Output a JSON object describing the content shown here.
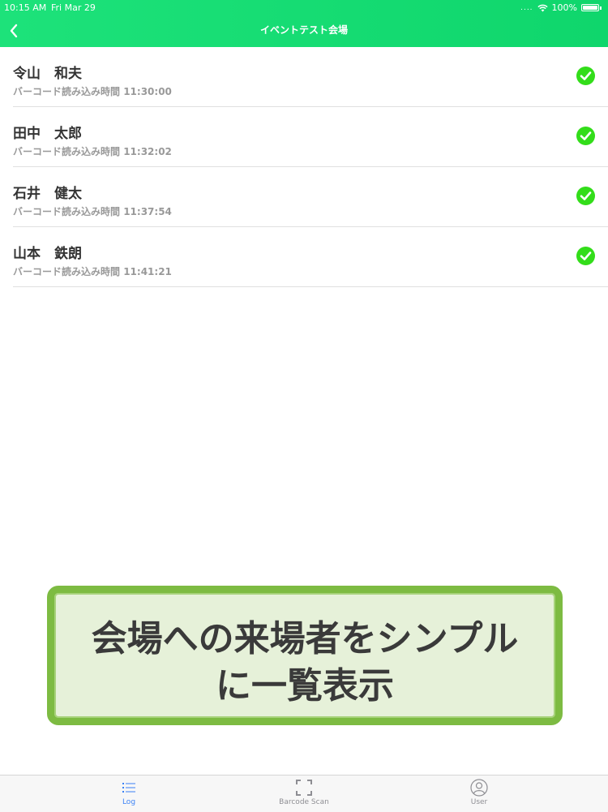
{
  "status_bar": {
    "time": "10:15 AM",
    "date": "Fri Mar 29",
    "signal": "....",
    "battery": "100%"
  },
  "nav": {
    "title": "イベントテスト会場",
    "back_icon": "chevron-left-icon"
  },
  "attendees": [
    {
      "name": "令山　和夫",
      "scan_label": "バーコード読み込み時間",
      "scan_time": "11:30:00",
      "status_icon": "check-circle-icon"
    },
    {
      "name": "田中　太郎",
      "scan_label": "バーコード読み込み時間",
      "scan_time": "11:32:02",
      "status_icon": "check-circle-icon"
    },
    {
      "name": "石井　健太",
      "scan_label": "バーコード読み込み時間",
      "scan_time": "11:37:54",
      "status_icon": "check-circle-icon"
    },
    {
      "name": "山本　鉄朗",
      "scan_label": "バーコード読み込み時間",
      "scan_time": "11:41:21",
      "status_icon": "check-circle-icon"
    }
  ],
  "banner": {
    "line1": "会場への来場者をシンプル",
    "line2": "に一覧表示"
  },
  "tabs": [
    {
      "label": "Log",
      "icon": "list-icon",
      "active": true
    },
    {
      "label": "Barcode Scan",
      "icon": "scan-frame-icon",
      "active": false
    },
    {
      "label": "User",
      "icon": "user-icon",
      "active": false
    }
  ],
  "colors": {
    "header_green": "#1de27a",
    "check_green": "#33dd1a",
    "active_tab": "#3b82f6",
    "inactive_tab": "#8e8e93",
    "banner_border": "#7dbb42"
  }
}
